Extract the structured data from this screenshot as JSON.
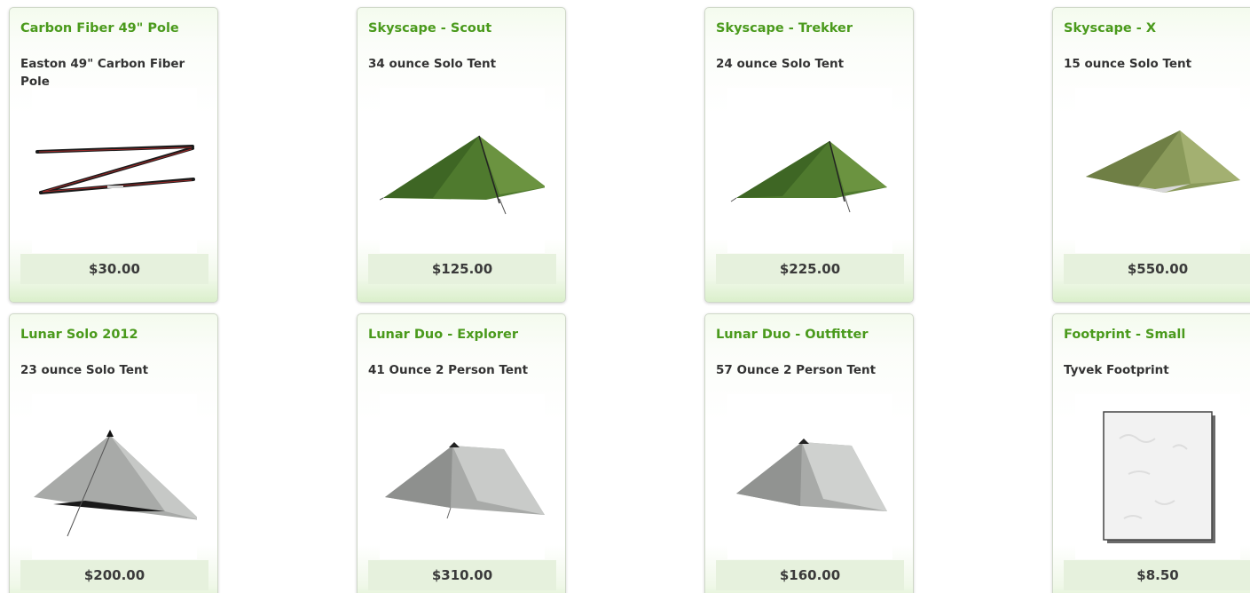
{
  "products": [
    {
      "title": "Carbon Fiber 49\" Pole",
      "subtitle": "Easton 49\" Carbon Fiber Pole",
      "price": "$30.00",
      "image": "pole-image"
    },
    {
      "title": "Skyscape - Scout",
      "subtitle": "34 ounce Solo Tent",
      "price": "$125.00",
      "image": "green-tent-image"
    },
    {
      "title": "Skyscape - Trekker",
      "subtitle": "24 ounce Solo Tent",
      "price": "$225.00",
      "image": "green-tent-image"
    },
    {
      "title": "Skyscape - X",
      "subtitle": "15 ounce Solo Tent",
      "price": "$550.00",
      "image": "olive-tent-image"
    },
    {
      "title": "Lunar Solo 2012",
      "subtitle": "23 ounce Solo Tent",
      "price": "$200.00",
      "image": "grey-solo-tent-image"
    },
    {
      "title": "Lunar Duo - Explorer",
      "subtitle": "41 Ounce 2 Person Tent",
      "price": "$310.00",
      "image": "grey-duo-tent-image"
    },
    {
      "title": "Lunar Duo - Outfitter",
      "subtitle": "57 Ounce 2 Person Tent",
      "price": "$160.00",
      "image": "grey-duo-tent-image"
    },
    {
      "title": "Footprint - Small",
      "subtitle": "Tyvek Footprint",
      "price": "$8.50",
      "image": "footprint-image"
    }
  ],
  "colors": {
    "title_green": "#4a9a1c",
    "price_bar_bg": "#e6f1dd",
    "tent_green": "#4f7a2e",
    "tent_olive": "#8a9a5a",
    "tent_grey": "#a8aaa8"
  }
}
